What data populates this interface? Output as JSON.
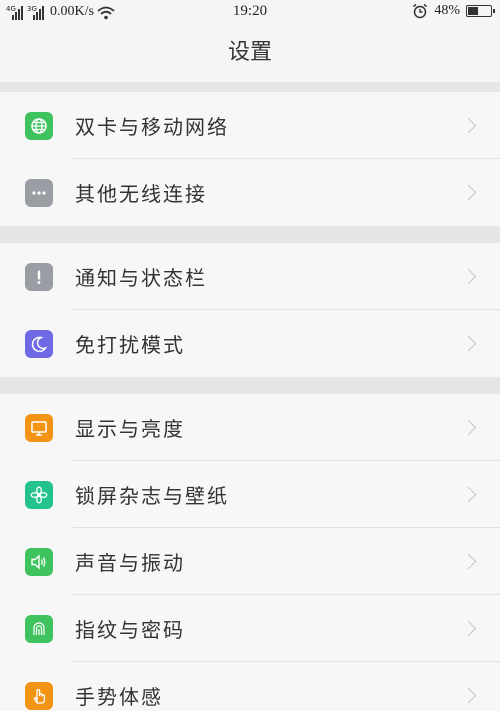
{
  "status_bar": {
    "signal1_net": "4G",
    "signal2_net": "3G",
    "speed": "0.00K/s",
    "time": "19:20",
    "battery": "48%",
    "battery_level_percent": 48
  },
  "header": {
    "title": "设置"
  },
  "groups": [
    {
      "items": [
        {
          "label": "双卡与移动网络",
          "icon": "globe-icon",
          "color": "#3fc35f"
        },
        {
          "label": "其他无线连接",
          "icon": "more-dots-icon",
          "color": "#9a9ea4"
        }
      ]
    },
    {
      "items": [
        {
          "label": "通知与状态栏",
          "icon": "exclamation-icon",
          "color": "#9a9ea4"
        },
        {
          "label": "免打扰模式",
          "icon": "moon-icon",
          "color": "#6f6ae3"
        }
      ]
    },
    {
      "items": [
        {
          "label": "显示与亮度",
          "icon": "monitor-icon",
          "color": "#f39415"
        },
        {
          "label": "锁屏杂志与壁纸",
          "icon": "flower-icon",
          "color": "#23c28f"
        },
        {
          "label": "声音与振动",
          "icon": "speaker-icon",
          "color": "#3fc35f"
        },
        {
          "label": "指纹与密码",
          "icon": "fingerprint-icon",
          "color": "#3fc35f"
        },
        {
          "label": "手势体感",
          "icon": "hand-gesture-icon",
          "color": "#f39415"
        }
      ]
    }
  ]
}
